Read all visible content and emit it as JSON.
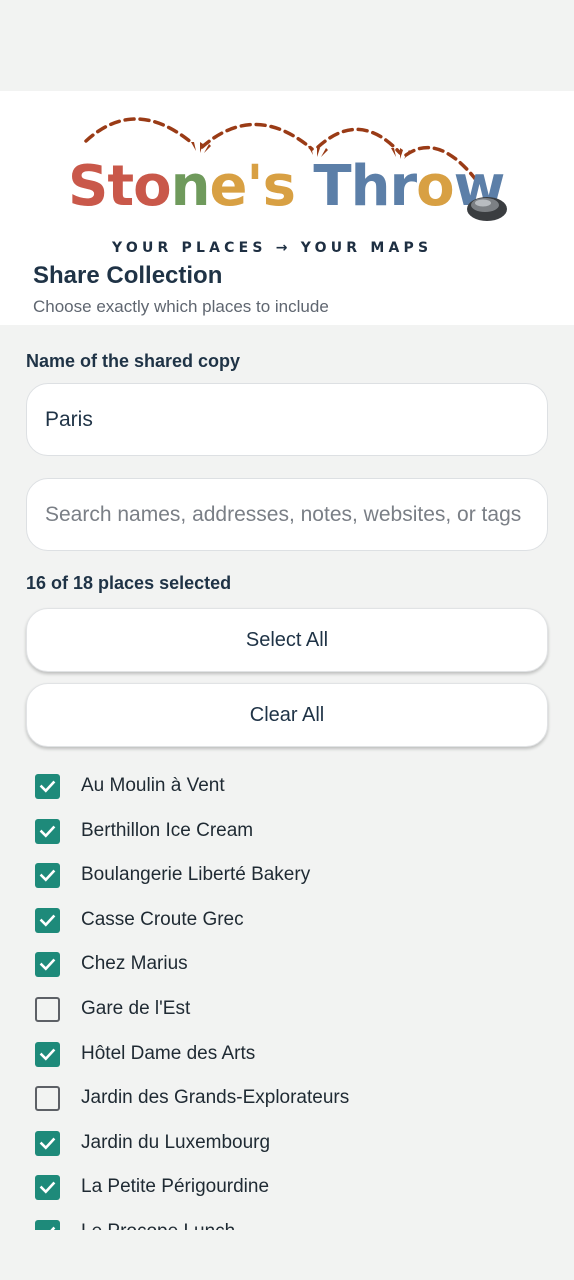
{
  "header": {
    "logo_parts": [
      "Sto",
      "n",
      "e's",
      " Thr",
      "o",
      "w"
    ],
    "tagline": "YOUR PLACES → YOUR MAPS",
    "title": "Share Collection",
    "subtitle": "Choose exactly which places to include"
  },
  "form": {
    "name_label": "Name of the shared copy",
    "name_value": "Paris",
    "search_placeholder": "Search names, addresses, notes, websites, or tags"
  },
  "selection": {
    "summary": "16 of 18 places selected",
    "select_all_label": "Select All",
    "clear_all_label": "Clear All"
  },
  "places": [
    {
      "name": "Au Moulin à Vent",
      "checked": true
    },
    {
      "name": "Berthillon Ice Cream",
      "checked": true
    },
    {
      "name": "Boulangerie Liberté Bakery",
      "checked": true
    },
    {
      "name": "Casse Croute Grec",
      "checked": true
    },
    {
      "name": "Chez Marius",
      "checked": true
    },
    {
      "name": "Gare de l'Est",
      "checked": false
    },
    {
      "name": "Hôtel Dame des Arts",
      "checked": true
    },
    {
      "name": "Jardin des Grands-Explorateurs",
      "checked": false
    },
    {
      "name": "Jardin du Luxembourg",
      "checked": true
    },
    {
      "name": "La Petite Périgourdine",
      "checked": true
    },
    {
      "name": "Le Procope Lunch",
      "checked": true
    }
  ],
  "colors": {
    "accent": "#1e8a7a",
    "text": "#1f3346",
    "background": "#f2f3f2",
    "logo_red": "#c9584a",
    "logo_gold": "#d8a043",
    "logo_green": "#6f9a5c",
    "logo_blue": "#5c7fa8",
    "logo_dash": "#9a3b16"
  }
}
